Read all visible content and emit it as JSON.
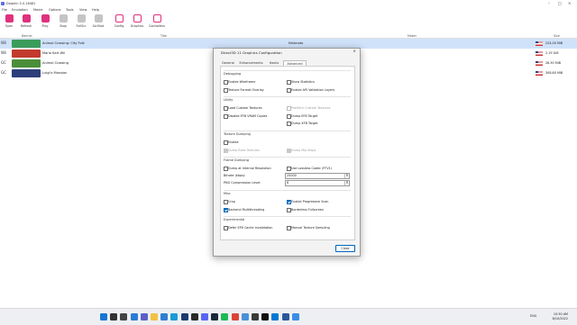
{
  "window": {
    "title": "Dolphin 5.0-16481"
  },
  "menu": [
    "File",
    "Emulation",
    "Movie",
    "Options",
    "Tools",
    "View",
    "Help"
  ],
  "toolbar": [
    {
      "label": "Open",
      "icon": "folder-open-icon",
      "style": "pink"
    },
    {
      "label": "Refresh",
      "icon": "refresh-icon",
      "style": "pink"
    },
    {
      "label": "Play",
      "icon": "play-icon",
      "style": "pink"
    },
    {
      "label": "Stop",
      "icon": "stop-icon",
      "style": "grey"
    },
    {
      "label": "FullScr",
      "icon": "fullscreen-icon",
      "style": "grey"
    },
    {
      "label": "ScrShot",
      "icon": "screenshot-icon",
      "style": "grey"
    },
    {
      "label": "Config",
      "icon": "config-icon",
      "style": "pinko"
    },
    {
      "label": "Graphics",
      "icon": "graphics-icon",
      "style": "pinko"
    },
    {
      "label": "Controllers",
      "icon": "controllers-icon",
      "style": "pinko"
    }
  ],
  "columns": {
    "banner": "Banner",
    "title": "Title",
    "maker": "Maker",
    "size": "Size"
  },
  "games": [
    {
      "platform": "Wii",
      "title": "Animal Crossing: City Folk",
      "maker": "Nintendo",
      "size": "224.00 MiB",
      "banner_color": "#3a9c5a",
      "selected": true
    },
    {
      "platform": "Wii",
      "title": "Mario Kart Wii",
      "maker": "",
      "size": "2.19 GiB",
      "banner_color": "#c23b2e",
      "selected": false
    },
    {
      "platform": "GC",
      "title": "Animal Crossing",
      "maker": "",
      "size": "28.50 MiB",
      "banner_color": "#4b8e3a",
      "selected": false
    },
    {
      "platform": "GC",
      "title": "Luigi's Mansion",
      "maker": "",
      "size": "308.60 MiB",
      "banner_color": "#2c3f7a",
      "selected": false
    }
  ],
  "dialog": {
    "title": "Direct3D 11 Graphics Configuration",
    "tabs": [
      "General",
      "Enhancements",
      "Hacks",
      "Advanced"
    ],
    "active_tab": "Advanced",
    "sections": {
      "debugging": "Debugging",
      "utility": "Utility",
      "texture_dumping": "Texture Dumping",
      "frame_dumping": "Frame Dumping",
      "misc": "Misc",
      "experimental": "Experimental"
    },
    "options": {
      "enable_wireframe": {
        "label": "Enable Wireframe",
        "checked": false,
        "disabled": false
      },
      "show_statistics": {
        "label": "Show Statistics",
        "checked": false,
        "disabled": false
      },
      "texture_format_overlay": {
        "label": "Texture Format Overlay",
        "checked": false,
        "disabled": false
      },
      "enable_api_validation": {
        "label": "Enable API Validation Layers",
        "checked": false,
        "disabled": false
      },
      "load_custom_textures": {
        "label": "Load Custom Textures",
        "checked": false,
        "disabled": false
      },
      "prefetch_custom_textures": {
        "label": "Prefetch Custom Textures",
        "checked": false,
        "disabled": true
      },
      "disable_efb_vram_copies": {
        "label": "Disable EFB VRAM Copies",
        "checked": false,
        "disabled": false
      },
      "dump_efb_target": {
        "label": "Dump EFB Target",
        "checked": false,
        "disabled": false
      },
      "dump_xfb_target": {
        "label": "Dump XFB Target",
        "checked": false,
        "disabled": false
      },
      "enable_texture_dump": {
        "label": "Enable",
        "checked": false,
        "disabled": false
      },
      "dump_base_textures": {
        "label": "Dump Base Textures",
        "checked": true,
        "disabled": true
      },
      "dump_mip_maps": {
        "label": "Dump Mip Maps",
        "checked": true,
        "disabled": true
      },
      "dump_internal_resolution": {
        "label": "Dump at Internal Resolution",
        "checked": false,
        "disabled": false
      },
      "use_lossless_codec": {
        "label": "Use Lossless Codec (FFV1)",
        "checked": false,
        "disabled": false
      },
      "crop": {
        "label": "Crop",
        "checked": false,
        "disabled": false
      },
      "enable_progressive_scan": {
        "label": "Enable Progressive Scan",
        "checked": true,
        "disabled": false
      },
      "backend_multithreading": {
        "label": "Backend Multithreading",
        "checked": true,
        "disabled": false
      },
      "borderless_fullscreen": {
        "label": "Borderless Fullscreen",
        "checked": false,
        "disabled": false
      },
      "defer_efb_cache_invalidation": {
        "label": "Defer EFB Cache Invalidation",
        "checked": false,
        "disabled": false
      },
      "manual_texture_sampling": {
        "label": "Manual Texture Sampling",
        "checked": false,
        "disabled": false
      }
    },
    "bitrate": {
      "label": "Bitrate (kbps):",
      "value": "25000"
    },
    "png_compression": {
      "label": "PNG Compression Level:",
      "value": "6"
    },
    "close_label": "Close"
  },
  "taskbar": {
    "time": "10:50 AM",
    "date": "8/10/2022",
    "lang": "ENG",
    "icons": [
      {
        "name": "start-icon",
        "color": "#1976d2"
      },
      {
        "name": "search-icon",
        "color": "#333333"
      },
      {
        "name": "task-view-icon",
        "color": "#444444"
      },
      {
        "name": "widgets-icon",
        "color": "#2b7bd6"
      },
      {
        "name": "chat-icon",
        "color": "#5b5fc7"
      },
      {
        "name": "file-explorer-icon",
        "color": "#f2c144"
      },
      {
        "name": "store-icon",
        "color": "#2d7fd3"
      },
      {
        "name": "edge-icon",
        "color": "#1a9ad8"
      },
      {
        "name": "photoshop-icon",
        "color": "#1b3b6f"
      },
      {
        "name": "terminal-icon",
        "color": "#2a2a2a"
      },
      {
        "name": "discord-icon",
        "color": "#5865f2"
      },
      {
        "name": "steam-icon",
        "color": "#1b2838"
      },
      {
        "name": "spotify-icon",
        "color": "#1db954"
      },
      {
        "name": "chrome-icon",
        "color": "#db4437"
      },
      {
        "name": "notepad-icon",
        "color": "#4a90d9"
      },
      {
        "name": "obs-icon",
        "color": "#3a3a3a"
      },
      {
        "name": "tiktok-icon",
        "color": "#111111"
      },
      {
        "name": "vscode-icon",
        "color": "#0078d4"
      },
      {
        "name": "word-icon",
        "color": "#2b579a"
      },
      {
        "name": "dolphin-icon",
        "color": "#3a8ee6"
      }
    ]
  }
}
